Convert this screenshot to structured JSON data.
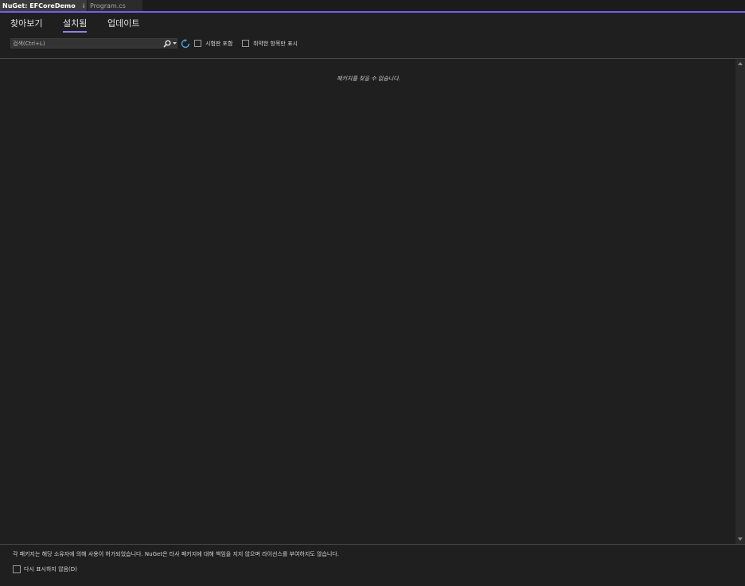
{
  "document_tabs": [
    {
      "label": "NuGet: EFCoreDemo",
      "active": true
    },
    {
      "label": "Program.cs",
      "active": false
    }
  ],
  "tab_icons": {
    "pin": "pin-icon",
    "close": "close-icon"
  },
  "nav": {
    "tabs": [
      {
        "label": "찾아보기",
        "selected": false
      },
      {
        "label": "설치됨",
        "selected": true
      },
      {
        "label": "업데이트",
        "selected": false
      }
    ]
  },
  "search": {
    "placeholder": "검색(Ctrl+L)",
    "value": ""
  },
  "filters": {
    "prerelease_label": "시험판 포함",
    "prerelease_checked": false,
    "vulnerable_label": "취약한 항목만 표시",
    "vulnerable_checked": false
  },
  "content": {
    "empty_message": "패키지를 찾을 수 없습니다."
  },
  "footer": {
    "license_note": "각 패키지는 해당 소유자에 의해 사용이 허가되었습니다. NuGet은 타사 패키지에 대해 책임을 지지 않으며 라이선스를 부여하지도 않습니다.",
    "dont_show_label": "다시 표시하지 않음(D)",
    "dont_show_checked": false
  },
  "colors": {
    "background": "#1f1f1f",
    "accent": "#7160e8",
    "selected_underline": "#8c82f0",
    "refresh_icon": "#4aa3df"
  }
}
